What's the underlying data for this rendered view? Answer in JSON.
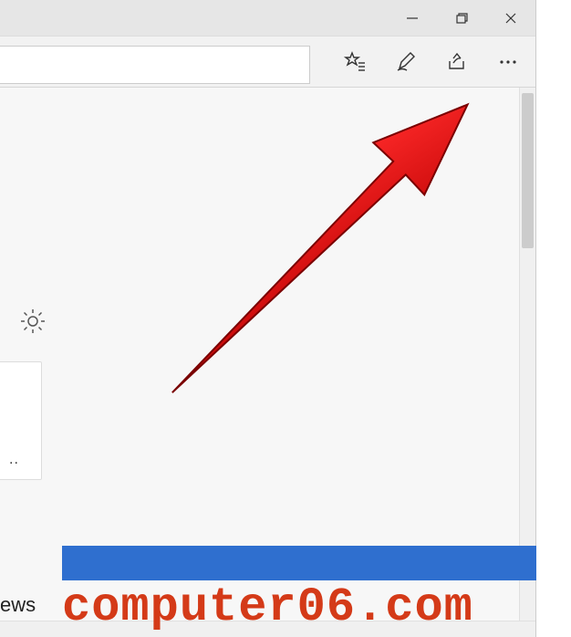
{
  "window": {
    "minimize_title": "Minimize",
    "maximize_title": "Restore",
    "close_title": "Close"
  },
  "toolbar": {
    "favorites_label": "Favorites",
    "notes_label": "Web Notes",
    "share_label": "Share",
    "more_label": "More"
  },
  "content": {
    "settings_label": "Settings",
    "card_ellipsis": "..",
    "ews_fragment": "ews"
  },
  "watermark": {
    "text": "computer06.com"
  }
}
